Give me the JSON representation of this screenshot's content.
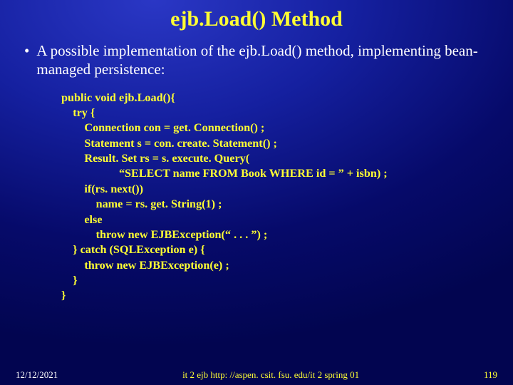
{
  "title": "ejb.Load() Method",
  "bullet": "A possible implementation of the ejb.Load() method, implementing bean-managed persistence:",
  "code": "public void ejb.Load(){\n    try {\n        Connection con = get. Connection() ;\n        Statement s = con. create. Statement() ;\n        Result. Set rs = s. execute. Query(\n                    “SELECT name FROM Book WHERE id = ” + isbn) ;\n        if(rs. next())\n            name = rs. get. String(1) ;\n        else\n            throw new EJBException(“ . . . ”) ;\n    } catch (SQLException e) {\n        throw new EJBException(e) ;\n    }\n}",
  "footer": {
    "date": "12/12/2021",
    "center": "it 2 ejb  http: //aspen. csit. fsu. edu/it 2 spring 01",
    "page": "119"
  }
}
